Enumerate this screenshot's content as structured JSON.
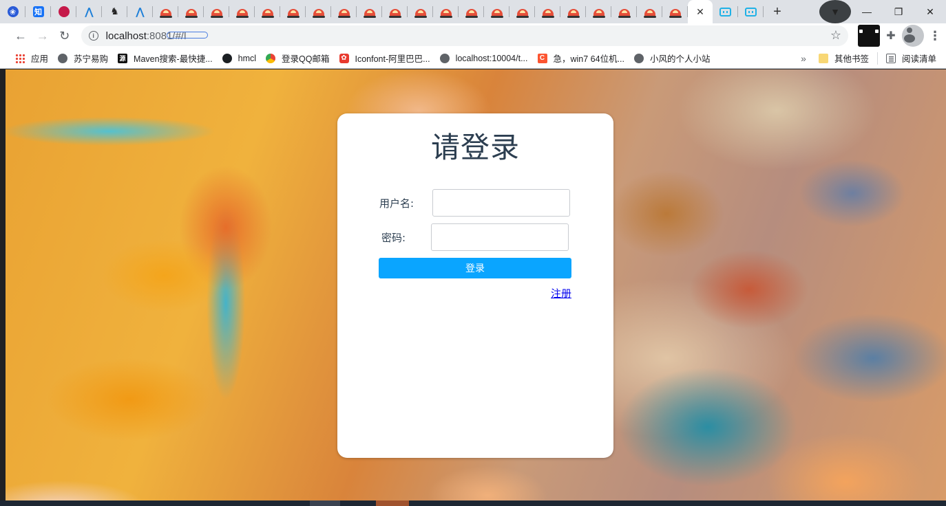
{
  "browser": {
    "tabs": {
      "active_close": "✕",
      "new_tab": "+"
    },
    "window_controls": {
      "minimize": "—",
      "maximize": "❐",
      "close": "✕"
    },
    "address_bar": {
      "url_host": "localhost",
      "url_rest": ":8081/#/l"
    },
    "bookmarks": [
      {
        "label": "应用",
        "icon": "apps-grid-icon"
      },
      {
        "label": "苏宁易购",
        "icon": "globe-icon"
      },
      {
        "label": "Maven搜索-最快捷...",
        "icon": "source-icon"
      },
      {
        "label": "hmcl",
        "icon": "github-icon"
      },
      {
        "label": "登录QQ邮箱",
        "icon": "qq-mail-icon"
      },
      {
        "label": "Iconfont-阿里巴巴...",
        "icon": "iconfont-icon"
      },
      {
        "label": "localhost:10004/t...",
        "icon": "globe-icon"
      },
      {
        "label": "急，win7 64位机...",
        "icon": "csdn-icon"
      },
      {
        "label": "小风的个人小站",
        "icon": "globe-icon"
      }
    ],
    "bookmarks_right": {
      "other_bookmarks": "其他书签",
      "reading_list": "阅读清单"
    }
  },
  "login": {
    "title": "请登录",
    "username_label": "用户名:",
    "username_value": "",
    "password_label": "密码:",
    "password_value": "",
    "submit_label": "登录",
    "register_label": "注册"
  },
  "colors": {
    "button_bg": "#0aa5ff",
    "title_color": "#2c3e50",
    "link_color": "#0000ee"
  }
}
